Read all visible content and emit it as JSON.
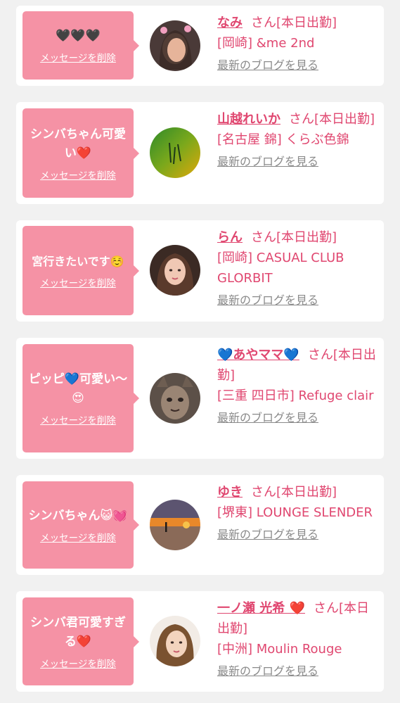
{
  "colors": {
    "accent": "#e04770",
    "bubble": "#f592a5",
    "card_bg": "#ffffff",
    "page_bg": "#f1f1f1",
    "link_gray": "#8a8a8a"
  },
  "labels": {
    "delete_message": "メッセージを削除",
    "latest_blog": "最新のブログを見る",
    "san_suffix": "さん[本日出勤]"
  },
  "cards": [
    {
      "message": "🖤🖤🖤",
      "name": "なみ",
      "shop": "[岡崎] &me 2nd"
    },
    {
      "message": "シンバちゃん可愛い❤️",
      "name": "山越れいか",
      "shop": "[名古屋 錦] くらぶ色錦"
    },
    {
      "message": "宮行きたいです☺️",
      "name": "らん",
      "shop": "[岡崎] CASUAL CLUB GLORBIT"
    },
    {
      "message": "ピッピ💙可愛い〜😍",
      "name": "💙あやママ💙",
      "shop": "[三重 四日市] Refuge clair"
    },
    {
      "message": "シンバちゃん😺💓",
      "name": "ゆき",
      "shop": "[堺東] LOUNGE SLENDER"
    },
    {
      "message": "シンバ君可愛すぎる❤️",
      "name": "一ノ瀬 光希 ❤️",
      "shop": "[中洲] Moulin Rouge"
    }
  ]
}
